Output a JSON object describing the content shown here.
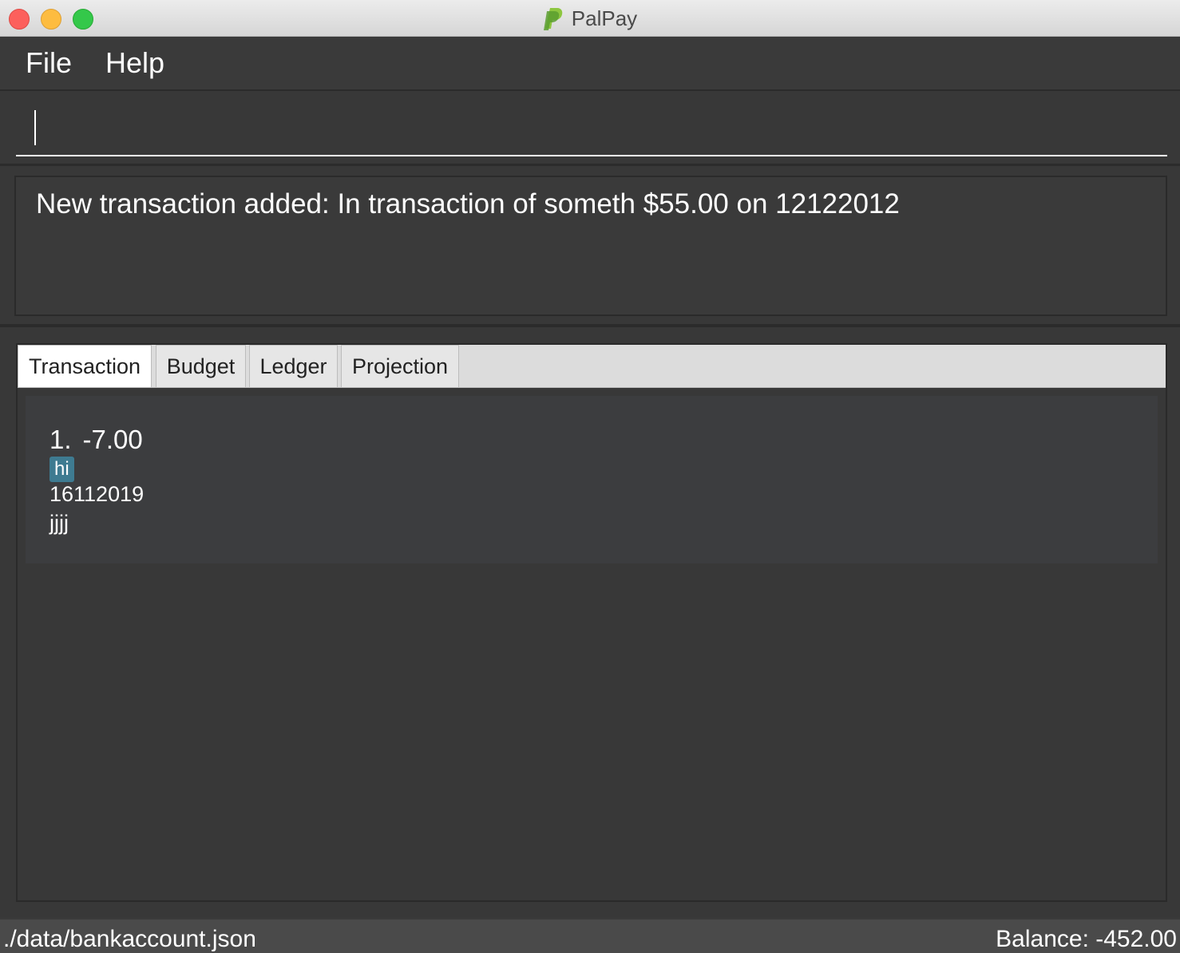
{
  "window": {
    "title": "PalPay",
    "icon": "paypal-p-icon"
  },
  "menu": {
    "items": [
      {
        "label": "File"
      },
      {
        "label": "Help"
      }
    ]
  },
  "command": {
    "value": "",
    "placeholder": ""
  },
  "result": {
    "message": "New transaction added: In transaction of someth $55.00 on 12122012"
  },
  "tabs": [
    {
      "label": "Transaction",
      "active": true
    },
    {
      "label": "Budget",
      "active": false
    },
    {
      "label": "Ledger",
      "active": false
    },
    {
      "label": "Projection",
      "active": false
    }
  ],
  "transactions": [
    {
      "index": "1.",
      "amount": "-7.00",
      "tag": "hi",
      "date": "16112019",
      "description": "jjjj"
    }
  ],
  "status": {
    "file_path": "./data/bankaccount.json",
    "balance": "Balance: -452.00"
  },
  "colors": {
    "background": "#383838",
    "tag": "#3e7b91",
    "close": "#fc605c",
    "minimize": "#fdbc40",
    "maximize": "#34c84a",
    "logo_green": "#6cb33f"
  }
}
